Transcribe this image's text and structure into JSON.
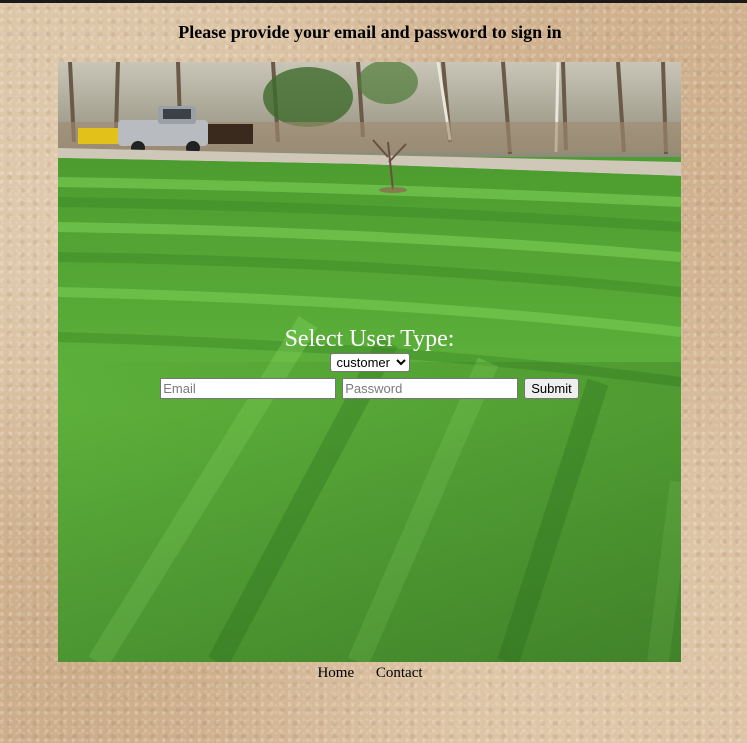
{
  "page": {
    "heading": "Please provide your email and password to sign in"
  },
  "hero": {
    "image_subject": "striped-lawn-with-pickup-truck"
  },
  "form": {
    "user_type_label": "Select User Type:",
    "user_type_selected": "customer",
    "email_placeholder": "Email",
    "password_placeholder": "Password",
    "submit_label": "Submit"
  },
  "footer": {
    "links": [
      "Home",
      "Contact"
    ]
  },
  "colors": {
    "background": "#d8bfa0",
    "lawn_light": "#6cc14a",
    "lawn_dark": "#3f8a2a",
    "heading_text": "#000000",
    "label_text": "#ffffff"
  }
}
